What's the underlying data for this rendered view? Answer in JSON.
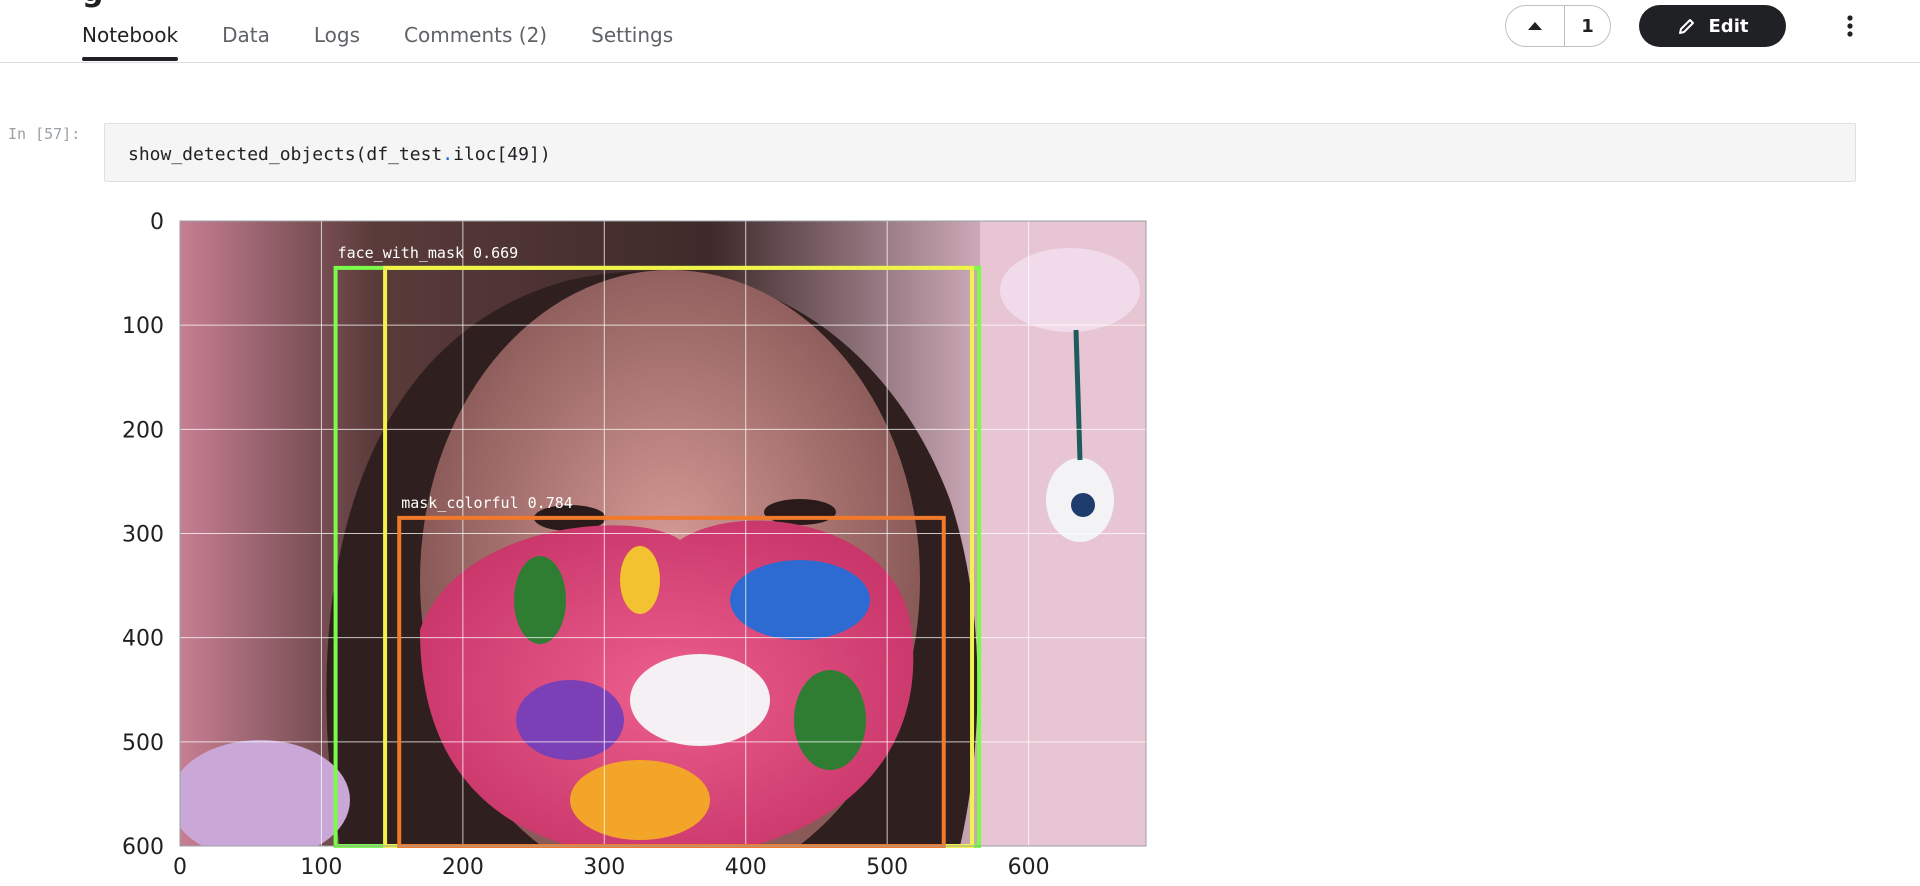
{
  "header": {
    "title_fragment": "g",
    "tabs": [
      {
        "label": "Notebook",
        "active": true
      },
      {
        "label": "Data",
        "active": false
      },
      {
        "label": "Logs",
        "active": false
      },
      {
        "label": "Comments (2)",
        "active": false
      },
      {
        "label": "Settings",
        "active": false
      }
    ],
    "vote_count": "1",
    "edit_label": "Edit",
    "icons": {
      "vote_up": "caret-up-icon",
      "edit": "pencil-icon",
      "more": "vertical-dots-icon"
    }
  },
  "cell": {
    "prompt": "In [57]:",
    "code_prefix": "show_detected_objects(df_test",
    "code_dot": ".",
    "code_suffix": "iloc[49])"
  },
  "output": {
    "image_description_colors": {
      "face_box": "#7cfc4a",
      "face_box_inner": "#f2f34a",
      "mask_box": "#f07a2a"
    },
    "detections": [
      {
        "label": "face_with_mask 0.669",
        "x1": 110,
        "y1": 45,
        "x2": 565,
        "y2": 600,
        "color": "#7cfc4a"
      },
      {
        "label": "",
        "x1": 145,
        "y1": 45,
        "x2": 560,
        "y2": 600,
        "color": "#f2f34a"
      },
      {
        "label": "mask_colorful 0.784",
        "x1": 155,
        "y1": 285,
        "x2": 540,
        "y2": 600,
        "color": "#f07a2a"
      }
    ]
  },
  "chart_data": {
    "type": "image",
    "xlim": [
      0,
      683
    ],
    "ylim": [
      600,
      0
    ],
    "x_ticks": [
      0,
      100,
      200,
      300,
      400,
      500,
      600
    ],
    "y_ticks": [
      0,
      100,
      200,
      300,
      400,
      500,
      600
    ],
    "grid": true
  }
}
